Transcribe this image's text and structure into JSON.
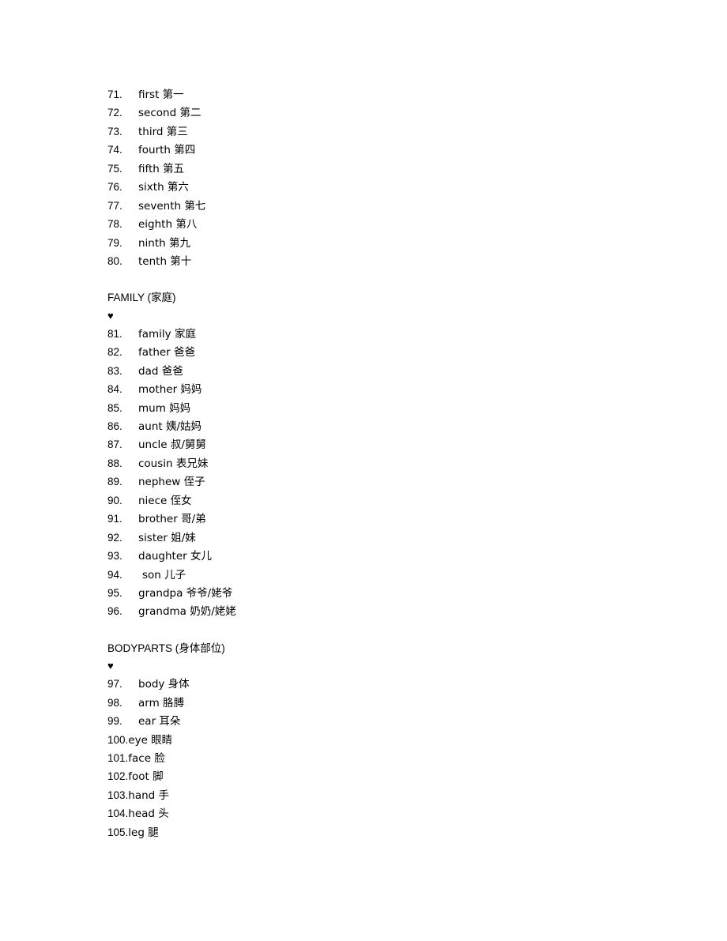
{
  "document": {
    "background_color": "#ffffff",
    "text_color": "#000000",
    "bullet_glyph": "♥"
  },
  "blocks": [
    {
      "kind": "list",
      "name": "ordinal-numbers-list",
      "items": [
        {
          "num": "71.",
          "text": "first 第一"
        },
        {
          "num": "72.",
          "text": "second 第二"
        },
        {
          "num": "73.",
          "text": "third 第三"
        },
        {
          "num": "74.",
          "text": "fourth 第四"
        },
        {
          "num": "75.",
          "text": "fifth 第五"
        },
        {
          "num": "76.",
          "text": "sixth 第六"
        },
        {
          "num": "77.",
          "text": "seventh 第七"
        },
        {
          "num": "78.",
          "text": "eighth 第八"
        },
        {
          "num": "79.",
          "text": "ninth 第九"
        },
        {
          "num": "80.",
          "text": "tenth 第十"
        }
      ]
    },
    {
      "kind": "spacer"
    },
    {
      "kind": "heading",
      "name": "section-heading-family",
      "text": "FAMILY (家庭)"
    },
    {
      "kind": "bullet",
      "name": "heart-bullet-family",
      "text": "♥"
    },
    {
      "kind": "list",
      "name": "family-list",
      "items": [
        {
          "num": "81.",
          "text": "family 家庭"
        },
        {
          "num": "82.",
          "text": "father 爸爸"
        },
        {
          "num": "83.",
          "text": "dad 爸爸"
        },
        {
          "num": "84.",
          "text": "mother 妈妈"
        },
        {
          "num": "85.",
          "text": "mum 妈妈"
        },
        {
          "num": "86.",
          "text": "aunt 姨/姑妈"
        },
        {
          "num": "87.",
          "text": "uncle 叔/舅舅"
        },
        {
          "num": "88.",
          "text": "cousin 表兄妹"
        },
        {
          "num": "89.",
          "text": "nephew 侄子"
        },
        {
          "num": "90.",
          "text": "niece 侄女"
        },
        {
          "num": "91.",
          "text": "brother 哥/弟"
        },
        {
          "num": "92.",
          "text": "sister 姐/妹"
        },
        {
          "num": "93.",
          "text": "daughter 女儿"
        },
        {
          "num": "94.",
          "text": "son 儿子",
          "extra_indent": true
        },
        {
          "num": "95.",
          "text": "grandpa 爷爷/姥爷"
        },
        {
          "num": "96.",
          "text": "grandma 奶奶/姥姥"
        }
      ]
    },
    {
      "kind": "spacer"
    },
    {
      "kind": "heading",
      "name": "section-heading-bodyparts",
      "text": "BODYPARTS (身体部位)"
    },
    {
      "kind": "bullet",
      "name": "heart-bullet-bodyparts",
      "text": "♥"
    },
    {
      "kind": "list",
      "name": "bodyparts-list",
      "items": [
        {
          "num": "97.",
          "text": "body 身体"
        },
        {
          "num": "98.",
          "text": "arm 胳膊"
        },
        {
          "num": "99.",
          "text": "ear 耳朵"
        },
        {
          "num": "100.",
          "text": "eye 眼睛",
          "wide": true
        },
        {
          "num": "101.",
          "text": "face 脸",
          "wide": true
        },
        {
          "num": "102.",
          "text": "foot 脚",
          "wide": true
        },
        {
          "num": "103.",
          "text": "hand 手",
          "wide": true
        },
        {
          "num": "104.",
          "text": "head 头",
          "wide": true
        },
        {
          "num": "105.",
          "text": "leg 腿",
          "wide": true
        }
      ]
    }
  ]
}
